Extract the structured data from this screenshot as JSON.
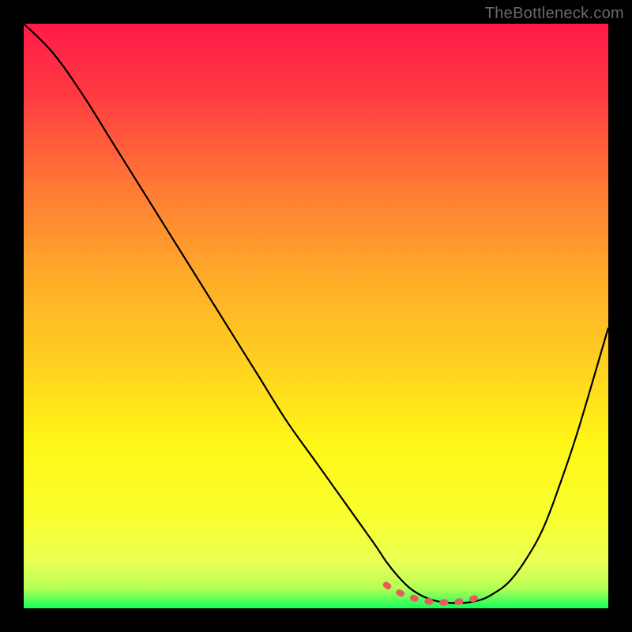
{
  "watermark": "TheBottleneck.com",
  "chart_data": {
    "type": "line",
    "title": "",
    "xlabel": "",
    "ylabel": "",
    "xlim": [
      0,
      100
    ],
    "ylim": [
      0,
      100
    ],
    "background_gradient": {
      "top": "#ff1a48",
      "upper_mid": "#ff7a35",
      "mid": "#ffd020",
      "lower_mid": "#fff716",
      "low": "#e9ff55",
      "bottom": "#14ff5a"
    },
    "series": [
      {
        "name": "bottleneck-curve",
        "color": "#000000",
        "x": [
          0,
          5,
          10,
          15,
          20,
          25,
          30,
          35,
          40,
          45,
          50,
          55,
          60,
          62,
          64,
          66,
          68,
          70,
          72,
          74,
          76,
          78,
          80,
          83,
          86,
          89,
          92,
          95,
          100
        ],
        "y": [
          100,
          95,
          88,
          80,
          72,
          64,
          56,
          48,
          40,
          32,
          25,
          18,
          11,
          8,
          5.5,
          3.5,
          2.2,
          1.4,
          1.0,
          0.9,
          1.0,
          1.4,
          2.3,
          4.5,
          8.5,
          14,
          22,
          31,
          48
        ]
      },
      {
        "name": "optimal-range-marker",
        "color": "#ea5a5a",
        "style": "dashed-thick",
        "x": [
          62,
          64,
          66,
          68,
          70,
          72,
          74,
          76,
          78,
          79
        ],
        "y": [
          4.0,
          2.8,
          2.0,
          1.4,
          1.1,
          1.0,
          1.1,
          1.4,
          2.0,
          2.6
        ]
      }
    ]
  }
}
